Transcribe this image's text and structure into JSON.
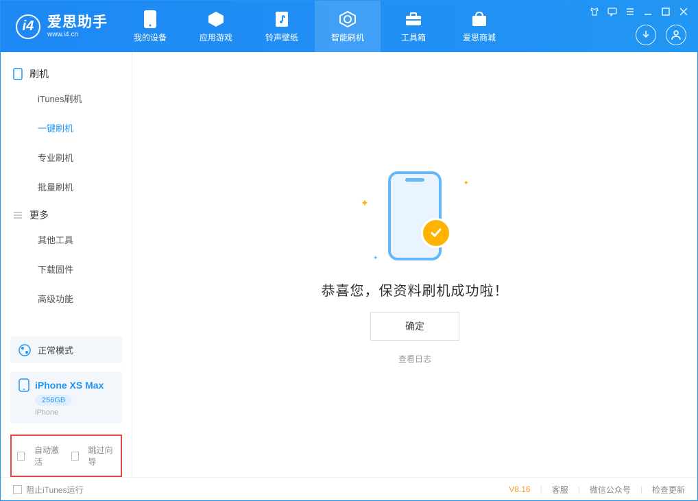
{
  "app": {
    "title": "爱思助手",
    "subtitle": "www.i4.cn"
  },
  "nav": [
    {
      "label": "我的设备",
      "icon": "device"
    },
    {
      "label": "应用游戏",
      "icon": "apps"
    },
    {
      "label": "铃声壁纸",
      "icon": "ringtone"
    },
    {
      "label": "智能刷机",
      "icon": "flash",
      "active": true
    },
    {
      "label": "工具箱",
      "icon": "toolbox"
    },
    {
      "label": "爱思商城",
      "icon": "store"
    }
  ],
  "sidebar": {
    "group1": {
      "title": "刷机",
      "items": [
        "iTunes刷机",
        "一键刷机",
        "专业刷机",
        "批量刷机"
      ],
      "active_index": 1
    },
    "group2": {
      "title": "更多",
      "items": [
        "其他工具",
        "下载固件",
        "高级功能"
      ]
    }
  },
  "mode": {
    "label": "正常模式"
  },
  "device": {
    "name": "iPhone XS Max",
    "capacity": "256GB",
    "type": "iPhone"
  },
  "bottom_options": {
    "auto_activate": "自动激活",
    "skip_wizard": "跳过向导"
  },
  "main": {
    "success_message": "恭喜您，保资料刷机成功啦！",
    "ok_button": "确定",
    "view_log": "查看日志"
  },
  "footer": {
    "block_itunes": "阻止iTunes运行",
    "version": "V8.16",
    "links": [
      "客服",
      "微信公众号",
      "检查更新"
    ]
  }
}
